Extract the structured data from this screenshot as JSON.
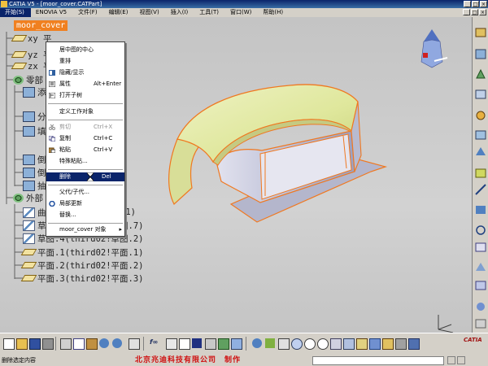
{
  "window": {
    "title": "CATIA V5 - [moor_cover.CATPart]",
    "controls": [
      "_",
      "□",
      "×"
    ]
  },
  "menu": [
    "开始(S)",
    "ENOVIA V5",
    "文件(F)",
    "编辑(E)",
    "视图(V)",
    "插入(I)",
    "工具(T)",
    "窗口(W)",
    "帮助(H)"
  ],
  "tree": {
    "root": "moor_cover",
    "nodes": [
      {
        "label": "xy 平",
        "icon": "plane-icon"
      },
      {
        "label": "yz 平",
        "icon": "plane-icon"
      },
      {
        "label": "zx 平",
        "icon": "plane-icon"
      },
      {
        "label": "零部",
        "icon": "gear-icon"
      },
      {
        "label": "添",
        "icon": "box-icon"
      },
      {
        "label": "分",
        "icon": "box-icon"
      },
      {
        "label": "填",
        "icon": "box-icon"
      },
      {
        "label": "倒",
        "icon": "box-icon"
      },
      {
        "label": "倒",
        "icon": "box-icon"
      },
      {
        "label": "抽",
        "icon": "box-icon"
      },
      {
        "label": "外部",
        "icon": "gear-icon"
      },
      {
        "label": "曲",
        "icon": "sketch-icon"
      },
      {
        "label": "草图.2(third02!草图.7)",
        "icon": "sketch-icon"
      },
      {
        "label": "草图.4(third02!草图.2)",
        "icon": "sketch-icon"
      },
      {
        "label": "平面.1(third02!平面.1)",
        "icon": "plane-icon"
      },
      {
        "label": "平面.2(third02!平面.2)",
        "icon": "plane-icon"
      },
      {
        "label": "平面.3(third02!平面.3)",
        "icon": "plane-icon"
      }
    ],
    "partial_suffix": ".1)"
  },
  "context_menu": {
    "items": [
      {
        "label": "居中图的中心",
        "shortcut": "",
        "state": "normal"
      },
      {
        "label": "重排",
        "shortcut": "",
        "state": "normal"
      },
      {
        "label": "隐藏/显示",
        "shortcut": "",
        "state": "normal"
      },
      {
        "label": "属性",
        "shortcut": "Alt+Enter",
        "state": "normal"
      },
      {
        "label": "打开子树",
        "shortcut": "",
        "state": "normal"
      },
      {
        "label": "定义工作对象",
        "shortcut": "",
        "state": "normal"
      },
      {
        "label": "剪切",
        "shortcut": "Ctrl+X",
        "state": "disabled"
      },
      {
        "label": "复制",
        "shortcut": "Ctrl+C",
        "state": "normal"
      },
      {
        "label": "粘贴",
        "shortcut": "Ctrl+V",
        "state": "normal"
      },
      {
        "label": "特殊粘贴...",
        "shortcut": "",
        "state": "normal"
      },
      {
        "label": "删除",
        "shortcut": "Del",
        "state": "selected"
      },
      {
        "label": "父代/子代...",
        "shortcut": "",
        "state": "normal"
      },
      {
        "label": "局部更新",
        "shortcut": "",
        "state": "normal"
      },
      {
        "label": "替换...",
        "shortcut": "",
        "state": "normal"
      },
      {
        "label": "moor_cover 对象",
        "shortcut": "",
        "state": "submenu"
      }
    ]
  },
  "status": {
    "message": "删除选定内容",
    "credit": "北京兆迪科技有限公司　制作",
    "logo": "CATIA"
  },
  "colors": {
    "surface": "#e4eba8",
    "edge": "#f07820",
    "highlight": "#0a246a",
    "menubar": "#d4d0c8"
  }
}
